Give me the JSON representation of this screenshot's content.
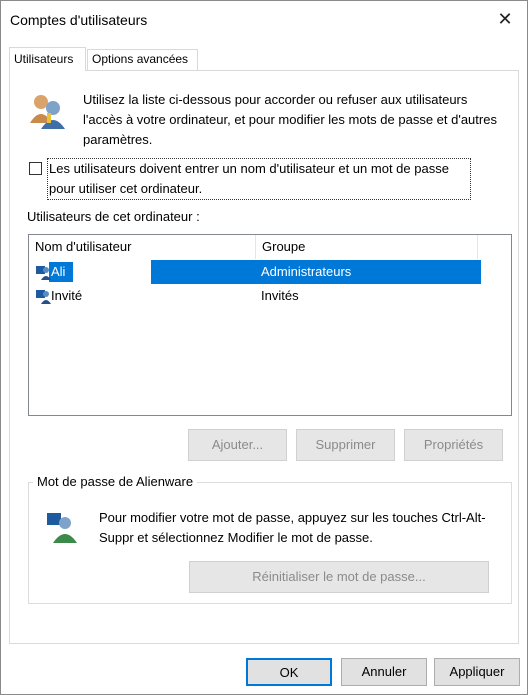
{
  "window": {
    "title": "Comptes d'utilisateurs",
    "close_glyph": "✕"
  },
  "tabs": [
    {
      "label": "Utilisateurs",
      "active": true
    },
    {
      "label": "Options avancées",
      "active": false
    }
  ],
  "intro": {
    "icon": "users-icon",
    "text": "Utilisez la liste ci-dessous pour accorder ou refuser aux utilisateurs l'accès à votre ordinateur, et pour modifier les mots de passe et d'autres paramètres."
  },
  "require_login": {
    "checked": false,
    "label": "Les utilisateurs doivent entrer un nom d'utilisateur et un mot de passe pour utiliser cet ordinateur."
  },
  "users_section": {
    "label": "Utilisateurs de cet ordinateur :",
    "columns": [
      "Nom d'utilisateur",
      "Groupe"
    ],
    "rows": [
      {
        "name": "Ali",
        "group": "Administrateurs",
        "selected": true,
        "icon": "user-icon"
      },
      {
        "name": "Invité",
        "group": "Invités",
        "selected": false,
        "icon": "user-icon"
      }
    ]
  },
  "buttons": {
    "add": "Ajouter...",
    "remove": "Supprimer",
    "properties": "Propriétés"
  },
  "password_box": {
    "title": "Mot de passe de Alienware",
    "icon": "user-key-icon",
    "text": "Pour modifier votre mot de passe, appuyez sur les touches Ctrl-Alt-Suppr et sélectionnez Modifier le mot de passe.",
    "reset_label": "Réinitialiser le mot de passe..."
  },
  "footer": {
    "ok": "OK",
    "cancel": "Annuler",
    "apply": "Appliquer"
  },
  "colors": {
    "selection": "#0078d7",
    "button_face": "#e1e1e1",
    "disabled_text": "#8b8b8b"
  }
}
